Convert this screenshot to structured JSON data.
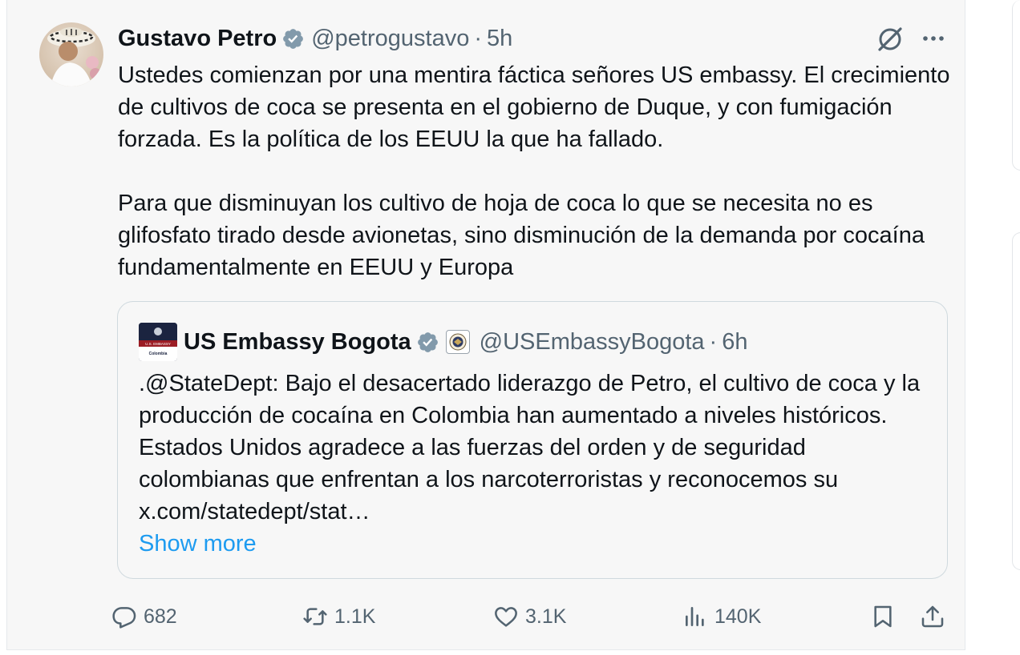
{
  "tweet": {
    "author": {
      "name": "Gustavo Petro",
      "handle": "@petrogustavo",
      "separator": "·",
      "time": "5h"
    },
    "text": "Ustedes comienzan por una mentira fáctica señores US embassy. El crecimiento de cultivos de coca se presenta en el gobierno de Duque, y con fumigación forzada. Es la política de los EEUU la que ha fallado.\n\nPara que disminuyan los cultivo de hoja de coca lo que se necesita no es glifosfato tirado desde avionetas, sino disminución de la demanda por cocaína fundamentalmente en EEUU y Europa",
    "quote": {
      "logo_text": "U.S. EMBASSY",
      "logo_subtext": "Colombia",
      "name": "US Embassy Bogota",
      "handle": "@USEmbassyBogota",
      "separator": "·",
      "time": "6h",
      "text": ".@StateDept: Bajo el desacertado liderazgo de Petro, el cultivo de coca y la producción de cocaína en Colombia han aumentado a niveles históricos. Estados Unidos agradece a las fuerzas del orden y de seguridad colombianas que enfrentan a los narcoterroristas y reconocemos su x.com/statedept/stat…",
      "show_more": "Show more"
    },
    "actions": {
      "replies": "682",
      "reposts": "1.1K",
      "likes": "3.1K",
      "views": "140K"
    }
  },
  "icons": {
    "verified": "verified-badge-icon",
    "grok": "grok-icon",
    "more": "more-icon",
    "reply": "reply-icon",
    "repost": "repost-icon",
    "like": "heart-icon",
    "views": "views-icon",
    "bookmark": "bookmark-icon",
    "share": "share-icon",
    "gov": "government-seal-icon"
  },
  "colors": {
    "background": "#f7f7f7",
    "text": "#0f1419",
    "secondary": "#536471",
    "link": "#1d9bf0",
    "verified": "#829aab"
  }
}
